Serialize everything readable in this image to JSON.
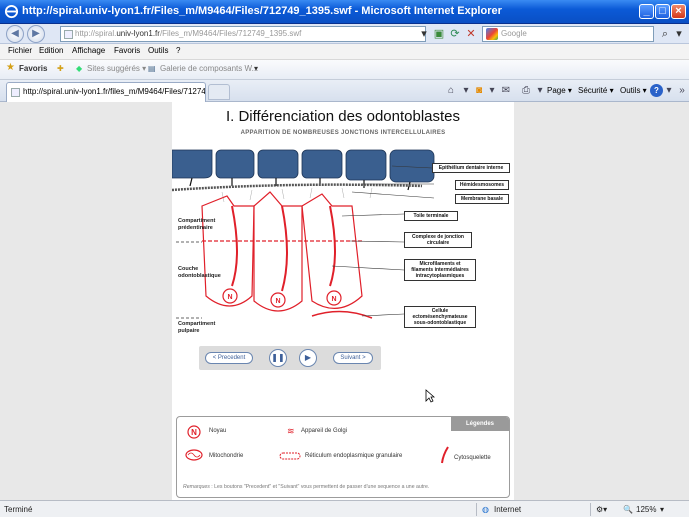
{
  "window": {
    "title": "http://spiral.univ-lyon1.fr/Files_m/M9464/Files/712749_1395.swf - Microsoft Internet Explorer",
    "minimize": "_",
    "maximize": "□",
    "close": "×"
  },
  "address": {
    "url_prefix": "http://spiral.",
    "url_domain": "univ-lyon1.fr",
    "url_path": "/Files_m/M9464/Files/712749_1395.swf",
    "search_placeholder": "Google"
  },
  "menu": [
    "Fichier",
    "Edition",
    "Affichage",
    "Favoris",
    "Outils",
    "?"
  ],
  "favorites": {
    "label": "Favoris",
    "items": [
      "Sites suggérés ▾",
      "Galerie de composants W..."
    ]
  },
  "tab": {
    "label": "http://spiral.univ-lyon1.fr/files_m/M9464/Files/71274..."
  },
  "toolbar": {
    "page": "Page ▾",
    "security": "Sécurité ▾",
    "tools": "Outils ▾",
    "help": "?"
  },
  "slide": {
    "title": "I. Différenciation des odontoblastes",
    "subtitle": "APPARITION DE NOMBREUSES JONCTIONS INTERCELLULAIRES",
    "left_labels": {
      "predentine": "Compartiment\nprédentinaire",
      "odontoblastic": "Couche\nodontoblastique",
      "pulp": "Compartiment\npulpaire"
    },
    "callouts": {
      "epithelium": "Epithélium dentaire interne",
      "hemidesmosomes": "Hémidesmosomes",
      "basal_membrane": "Membrane basale",
      "terminal_web": "Toile terminale",
      "junction_complex": "Complexe de jonction\ncirculaire",
      "microfilaments": "Microfilaments et\nfilaments intermédiaires\nintracytoplasmiques",
      "mesenchymal": "Cellule\nectomésenchymateuse\nsous-odontoblastique"
    },
    "nucleus_letter": "N"
  },
  "controls": {
    "prev": "< Precedent",
    "next": "Suivant >",
    "pause_icon": "pause-icon",
    "play_icon": "play-icon"
  },
  "legend": {
    "tab": "Légendes",
    "nucleus_letter": "N",
    "noyau": "Noyau",
    "golgi": "Appareil de Golgi",
    "mito": "Mitochondrie",
    "reticulum": "Réticulum endoplasmique granulaire",
    "cyto": "Cytosquelette",
    "remarks_label": "Remarques",
    "remarks_text": " : Les boutons \"Precedent\" et \"Suivant\" vous permettent de passer d'une sequence a une autre."
  },
  "status": {
    "left": "Terminé",
    "zone": "Internet",
    "zoom": "125%"
  },
  "colors": {
    "accent_red": "#e0202a",
    "epithelium_blue": "#3a5f8f",
    "ie_blue": "#0b5ad7"
  }
}
